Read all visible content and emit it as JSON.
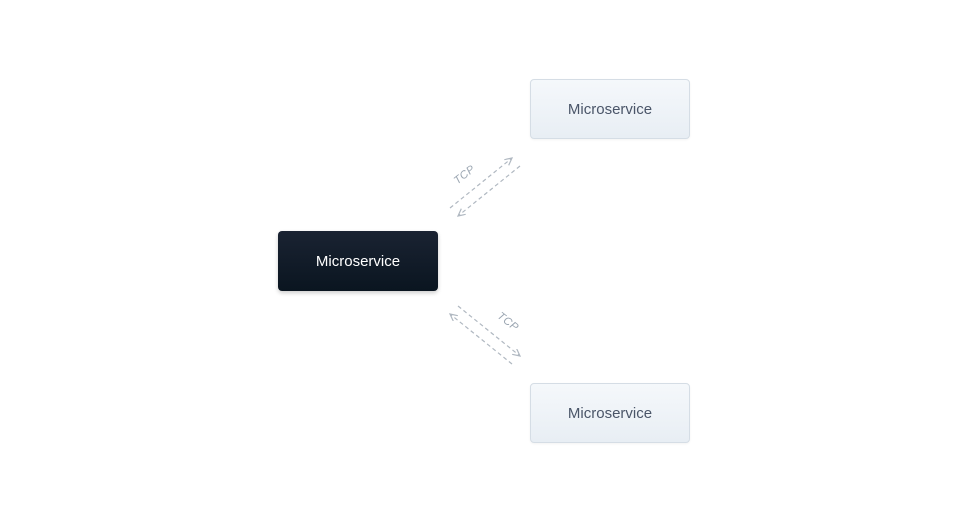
{
  "diagram": {
    "nodes": {
      "central": {
        "label": "Microservice",
        "style": "dark"
      },
      "topRight": {
        "label": "Microservice",
        "style": "light"
      },
      "bottomRight": {
        "label": "Microservice",
        "style": "light"
      }
    },
    "connectors": {
      "top": {
        "label": "TCP",
        "protocol": "TCP",
        "bidirectional": true
      },
      "bottom": {
        "label": "TCP",
        "protocol": "TCP",
        "bidirectional": true
      }
    },
    "colors": {
      "darkNodeBg": "#111c2b",
      "lightNodeBg": "#eef3f8",
      "lightNodeText": "#4a5568",
      "connectorStroke": "#b0b8c1",
      "labelColor": "#9aa5b1"
    }
  }
}
